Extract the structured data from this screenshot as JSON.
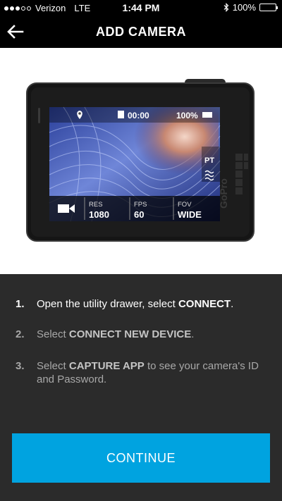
{
  "status_bar": {
    "carrier": "Verizon",
    "network": "LTE",
    "time": "1:44 PM",
    "battery": "100%",
    "battery_level": 1.0
  },
  "nav": {
    "title": "ADD CAMERA",
    "back_icon": "arrow-left-icon"
  },
  "camera_screen": {
    "timer": "00:00",
    "battery": "100%",
    "res_label": "RES",
    "res_value": "1080",
    "fps_label": "FPS",
    "fps_value": "60",
    "fov_label": "FOV",
    "fov_value": "WIDE",
    "pt_label": "PT",
    "brand": "GoPro"
  },
  "steps": [
    {
      "number": "1.",
      "text_before": "Open the utility drawer, select ",
      "bold": "CONNECT",
      "text_after": "."
    },
    {
      "number": "2.",
      "text_before": "Select ",
      "bold": "CONNECT NEW DEVICE",
      "text_after": "."
    },
    {
      "number": "3.",
      "text_before": "Select ",
      "bold": "CAPTURE APP",
      "text_after": " to see your camera's ID and Password."
    }
  ],
  "continue_label": "CONTINUE",
  "colors": {
    "accent": "#00a3e0",
    "panel": "#2b2b2b",
    "battery_green": "#4cd964"
  }
}
